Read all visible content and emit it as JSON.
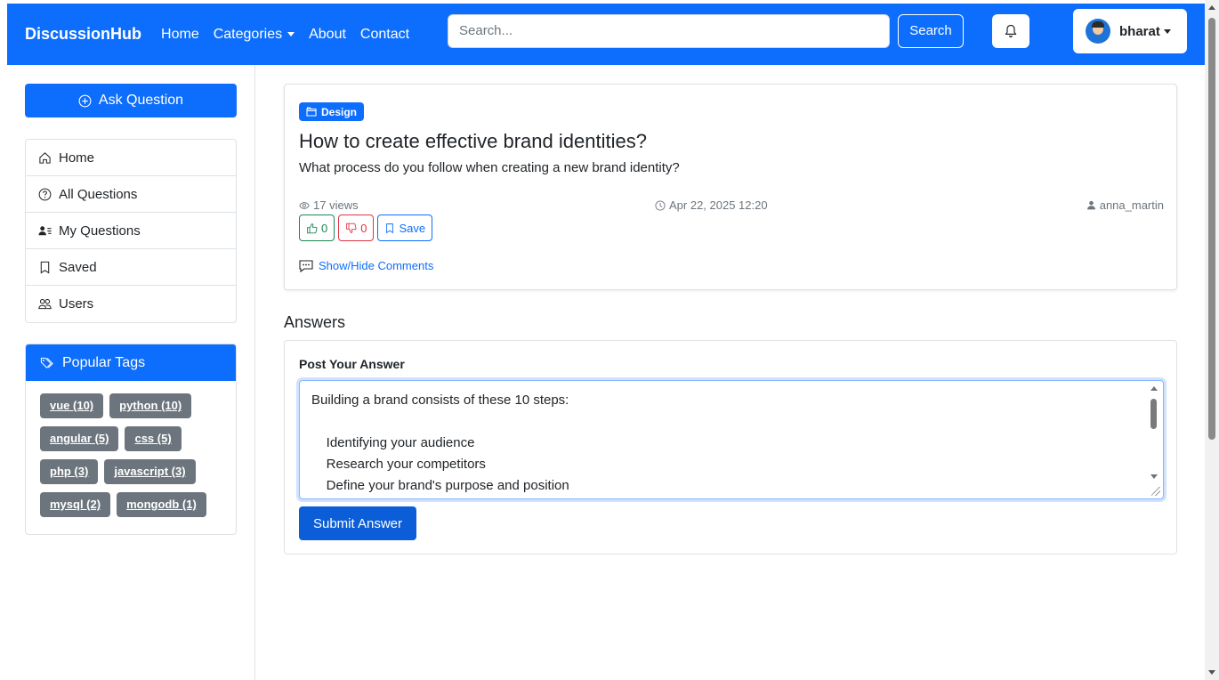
{
  "navbar": {
    "brand": "DiscussionHub",
    "links": [
      "Home",
      "Categories",
      "About",
      "Contact"
    ],
    "search_placeholder": "Search...",
    "search_button": "Search",
    "user_name": "bharat",
    "color": "#0d6efd"
  },
  "sidebar": {
    "ask_button": "Ask Question",
    "items": [
      {
        "label": "Home",
        "icon": "house-icon"
      },
      {
        "label": "All Questions",
        "icon": "question-circle-icon"
      },
      {
        "label": "My Questions",
        "icon": "person-lines-icon"
      },
      {
        "label": "Saved",
        "icon": "bookmark-icon"
      },
      {
        "label": "Users",
        "icon": "people-icon"
      }
    ],
    "tags_title": "Popular Tags",
    "tags": [
      "vue (10)",
      "python (10)",
      "angular (5)",
      "css (5)",
      "php (3)",
      "javascript (3)",
      "mysql (2)",
      "mongodb (1)"
    ]
  },
  "question": {
    "category": "Design",
    "title": "How to create effective brand identities?",
    "body": "What process do you follow when creating a new brand identity?",
    "views": "17 views",
    "date": "Apr 22, 2025 12:20",
    "author": "anna_martin",
    "upvotes": "0",
    "downvotes": "0",
    "save_label": "Save",
    "comments_toggle": "Show/Hide Comments"
  },
  "answers": {
    "heading": "Answers",
    "post_label": "Post Your Answer",
    "draft_text": "Building a brand consists of these 10 steps:\n\n    Identifying your audience\n    Research your competitors\n    Define your brand's purpose and position",
    "submit_button": "Submit Answer"
  }
}
